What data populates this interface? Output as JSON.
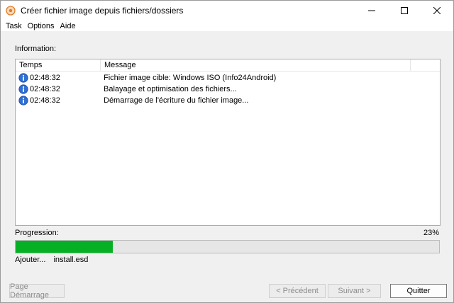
{
  "window": {
    "title": "Créer fichier image depuis fichiers/dossiers"
  },
  "menu": {
    "items": [
      "Task",
      "Options",
      "Aide"
    ]
  },
  "information": {
    "label": "Information:",
    "columns": [
      "Temps",
      "Message"
    ],
    "rows": [
      {
        "icon": "info-icon",
        "time": "02:48:32",
        "message": "Fichier image cible:  Windows ISO (Info24Android)"
      },
      {
        "icon": "info-icon",
        "time": "02:48:32",
        "message": "Balayage et optimisation des fichiers..."
      },
      {
        "icon": "info-icon",
        "time": "02:48:32",
        "message": "Démarrage de l'écriture du fichier image..."
      }
    ]
  },
  "progress": {
    "label": "Progression:",
    "percent_text": "23%",
    "value": 0.23,
    "color": "#06b025"
  },
  "status": {
    "action": "Ajouter...",
    "file": "install.esd"
  },
  "buttons": {
    "start_page": "Page Démarrage",
    "previous": "< Précédent",
    "next": "Suivant >",
    "quit": "Quitter"
  }
}
